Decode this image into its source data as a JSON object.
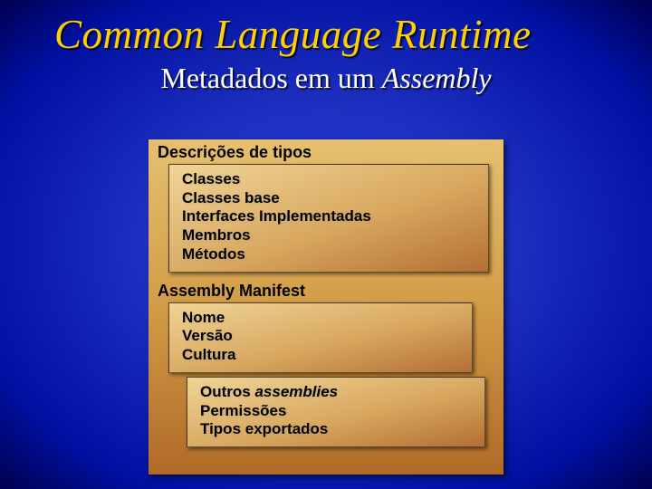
{
  "title": "Common Language Runtime",
  "subtitle_plain": "Metadados em um ",
  "subtitle_em": "Assembly",
  "sections": [
    {
      "label": "Descrições de tipos",
      "boxes": [
        {
          "cls": "box-a",
          "items": [
            {
              "text": "Classes"
            },
            {
              "text": "Classes base"
            },
            {
              "text": "Interfaces Implementadas"
            },
            {
              "text": "Membros"
            },
            {
              "text": "Métodos"
            }
          ]
        }
      ]
    },
    {
      "label": "Assembly Manifest",
      "boxes": [
        {
          "cls": "box-b",
          "items": [
            {
              "text": "Nome"
            },
            {
              "text": "Versão"
            },
            {
              "text": "Cultura"
            }
          ]
        },
        {
          "cls": "box-c",
          "items": [
            {
              "plain": "Outros ",
              "em": "assemblies"
            },
            {
              "text": "Permissões"
            },
            {
              "text": "Tipos exportados"
            }
          ]
        }
      ]
    }
  ]
}
